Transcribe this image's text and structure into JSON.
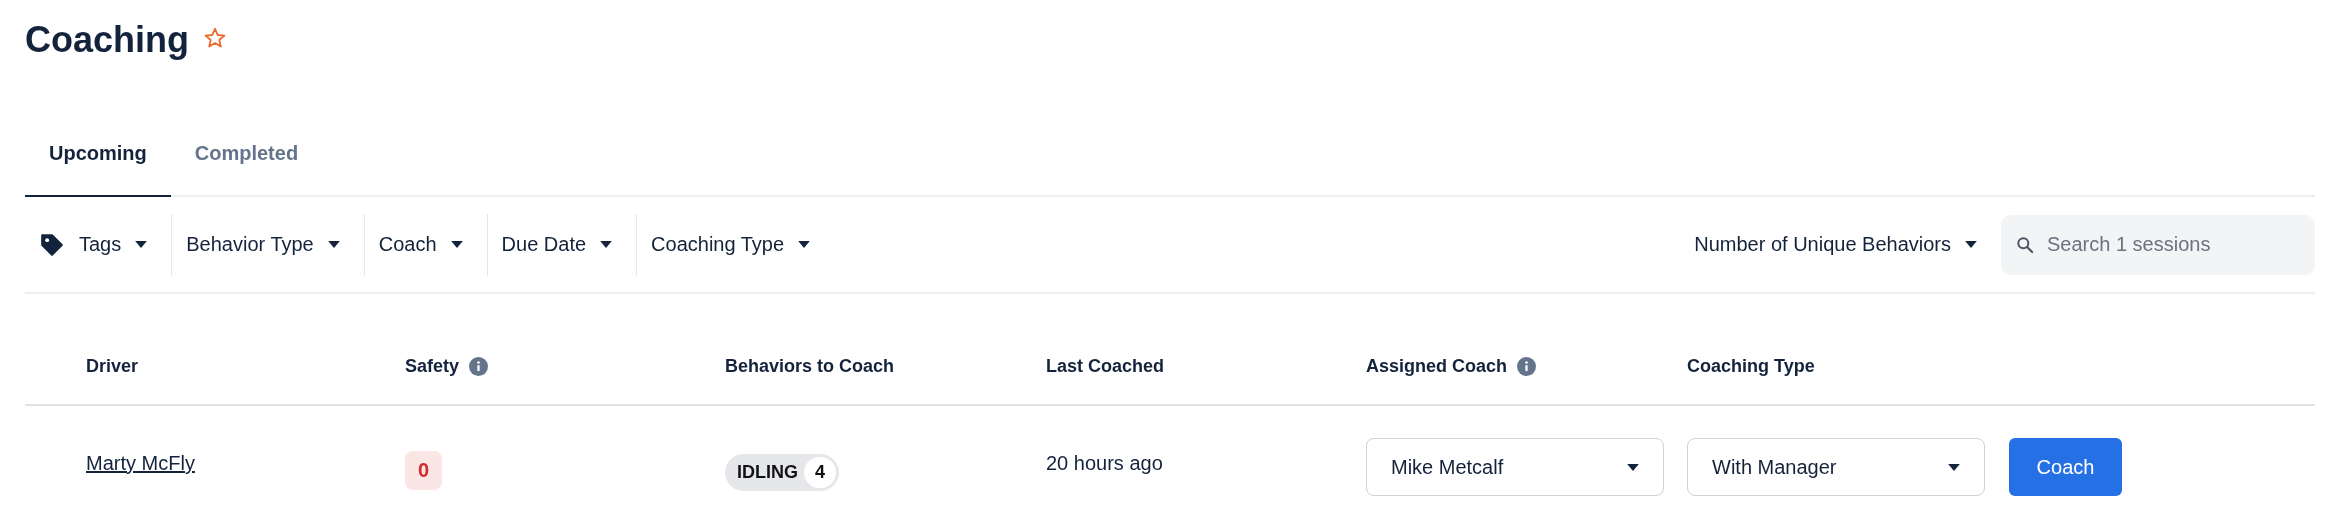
{
  "page": {
    "title": "Coaching",
    "favorite": false
  },
  "tabs": [
    {
      "label": "Upcoming",
      "selected": true
    },
    {
      "label": "Completed",
      "selected": false
    }
  ],
  "filters": [
    {
      "label": "Tags",
      "kind": "tag"
    },
    {
      "label": "Behavior Type",
      "kind": "plain"
    },
    {
      "label": "Coach",
      "kind": "plain"
    },
    {
      "label": "Due Date",
      "kind": "plain"
    },
    {
      "label": "Coaching Type",
      "kind": "plain"
    }
  ],
  "sort": {
    "label": "Number of Unique Behaviors"
  },
  "search": {
    "placeholder": "Search 1 sessions"
  },
  "table": {
    "columns": [
      {
        "label": "Driver",
        "info": false
      },
      {
        "label": "Safety",
        "info": true
      },
      {
        "label": "Behaviors to Coach",
        "info": false
      },
      {
        "label": "Last Coached",
        "info": false
      },
      {
        "label": "Assigned Coach",
        "info": true
      },
      {
        "label": "Coaching Type",
        "info": false
      }
    ],
    "rows": [
      {
        "driver": "Marty McFly",
        "safety": "0",
        "behaviors": [
          {
            "label": "IDLING",
            "count": "4"
          }
        ],
        "last_coached": "20 hours ago",
        "assigned_coach": "Mike Metcalf",
        "coaching_type": "With Manager",
        "action": "Coach"
      }
    ]
  }
}
